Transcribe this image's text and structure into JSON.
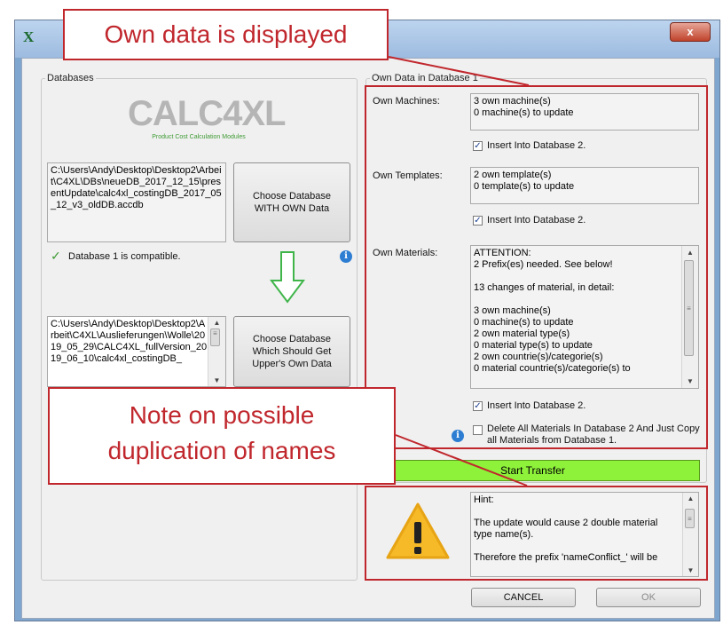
{
  "window": {
    "close_glyph": "x",
    "app_icon_letter": "X"
  },
  "databases": {
    "legend": "Databases",
    "logo_main": "CALC4XL",
    "logo_tagline": "Product Cost Calculation Modules",
    "db1_path": "C:\\Users\\Andy\\Desktop\\Desktop2\\Arbeit\\C4XL\\DBs\\neueDB_2017_12_15\\presentUpdate\\calc4xl_costingDB_2017_05_12_v3_oldDB.accdb",
    "db1_button": "Choose Database WITH OWN Data",
    "db1_status": "Database 1 is compatible.",
    "db2_path": "C:\\Users\\Andy\\Desktop\\Desktop2\\Arbeit\\C4XL\\Auslieferungen\\Wolle\\2019_05_29\\CALC4XL_fullVersion_2019_06_10\\calc4xl_costingDB_",
    "db2_button": "Choose Database Which Should Get Upper's Own Data"
  },
  "own_data": {
    "legend": "Own Data in Database 1",
    "machines_label": "Own Machines:",
    "machines_line1": "3 own machine(s)",
    "machines_line2": "0 machine(s) to update",
    "machines_insert": "Insert Into Database 2.",
    "templates_label": "Own Templates:",
    "templates_line1": "2 own template(s)",
    "templates_line2": "0 template(s) to update",
    "templates_insert": "Insert Into Database 2.",
    "materials_label": "Own Materials:",
    "materials_lines": [
      "ATTENTION:",
      "2 Prefix(es) needed. See below!",
      "",
      "13 changes of material, in detail:",
      "",
      "3 own machine(s)",
      "0 machine(s) to update",
      "2 own material type(s)",
      "0 material type(s) to update",
      "2 own countrie(s)/categorie(s)",
      "0 material countrie(s)/categorie(s) to"
    ],
    "materials_insert": "Insert Into Database 2.",
    "delete_all": "Delete All Materials In Database 2 And Just Copy all Materials from Database 1."
  },
  "transfer": {
    "start_button": "Start Transfer"
  },
  "hint": {
    "lines": [
      "Hint:",
      "",
      "The update would cause 2 double material type name(s).",
      "",
      "Therefore the prefix 'nameConflict_' will be"
    ]
  },
  "footer": {
    "cancel": "CANCEL",
    "ok": "OK"
  },
  "annotations": {
    "top": "Own data is displayed",
    "bottom_line1": "Note on possible",
    "bottom_line2": "duplication of names"
  },
  "colors": {
    "annotation_red": "#c0272d",
    "start_green": "#8ef23a",
    "logo_green": "#3f9b35"
  }
}
